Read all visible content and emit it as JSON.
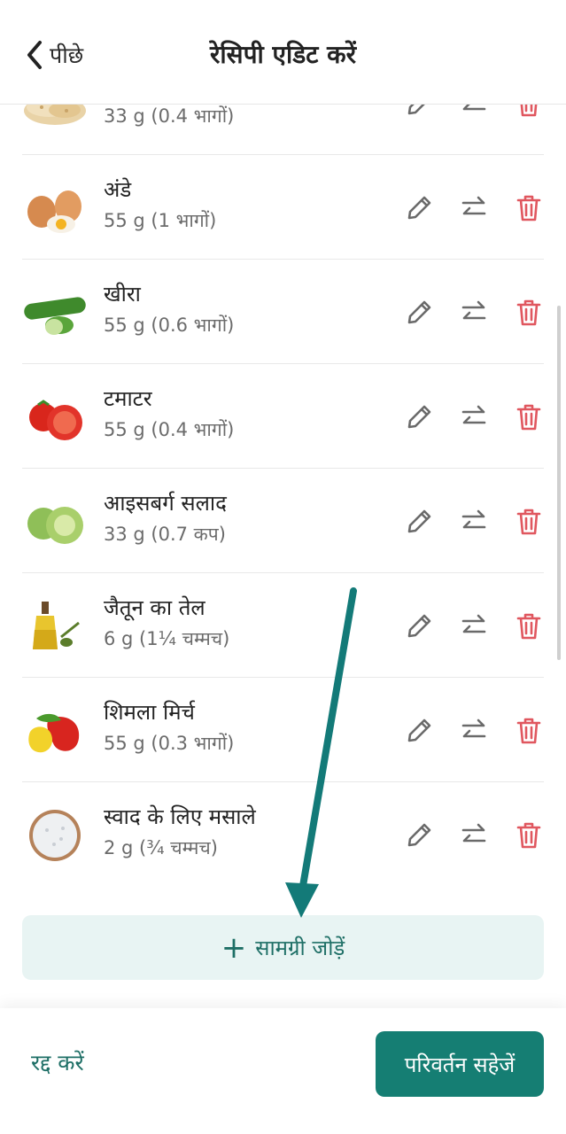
{
  "header": {
    "back_label": "पीछे",
    "title": "रेसिपी एडिट करें"
  },
  "ingredients": [
    {
      "name": "",
      "amount": "33 g (0.4 भागों)",
      "icon": "tortilla-image"
    },
    {
      "name": "अंडे",
      "amount": "55 g (1 भागों)",
      "icon": "eggs-image"
    },
    {
      "name": "खीरा",
      "amount": "55 g (0.6 भागों)",
      "icon": "cucumber-image"
    },
    {
      "name": "टमाटर",
      "amount": "55 g (0.4 भागों)",
      "icon": "tomato-image"
    },
    {
      "name": "आइसबर्ग सलाद",
      "amount": "33 g (0.7 कप)",
      "icon": "lettuce-image"
    },
    {
      "name": "जैतून का तेल",
      "amount": "6 g (1¼ चम्मच)",
      "icon": "olive-oil-image"
    },
    {
      "name": "शिमला मिर्च",
      "amount": "55 g (0.3 भागों)",
      "icon": "bell-pepper-image"
    },
    {
      "name": "स्वाद के लिए मसाले",
      "amount": "2 g (¾ चम्मच)",
      "icon": "spices-image"
    }
  ],
  "add_ingredient": {
    "label": "सामग्री जोड़ें",
    "icon": "plus-icon"
  },
  "footer": {
    "cancel_label": "रद्द करें",
    "save_label": "परिवर्तन सहेजें"
  },
  "colors": {
    "accent": "#157e73",
    "delete": "#e0575f",
    "add_bg": "#e8f4f3",
    "annotation_arrow": "#137a78"
  }
}
